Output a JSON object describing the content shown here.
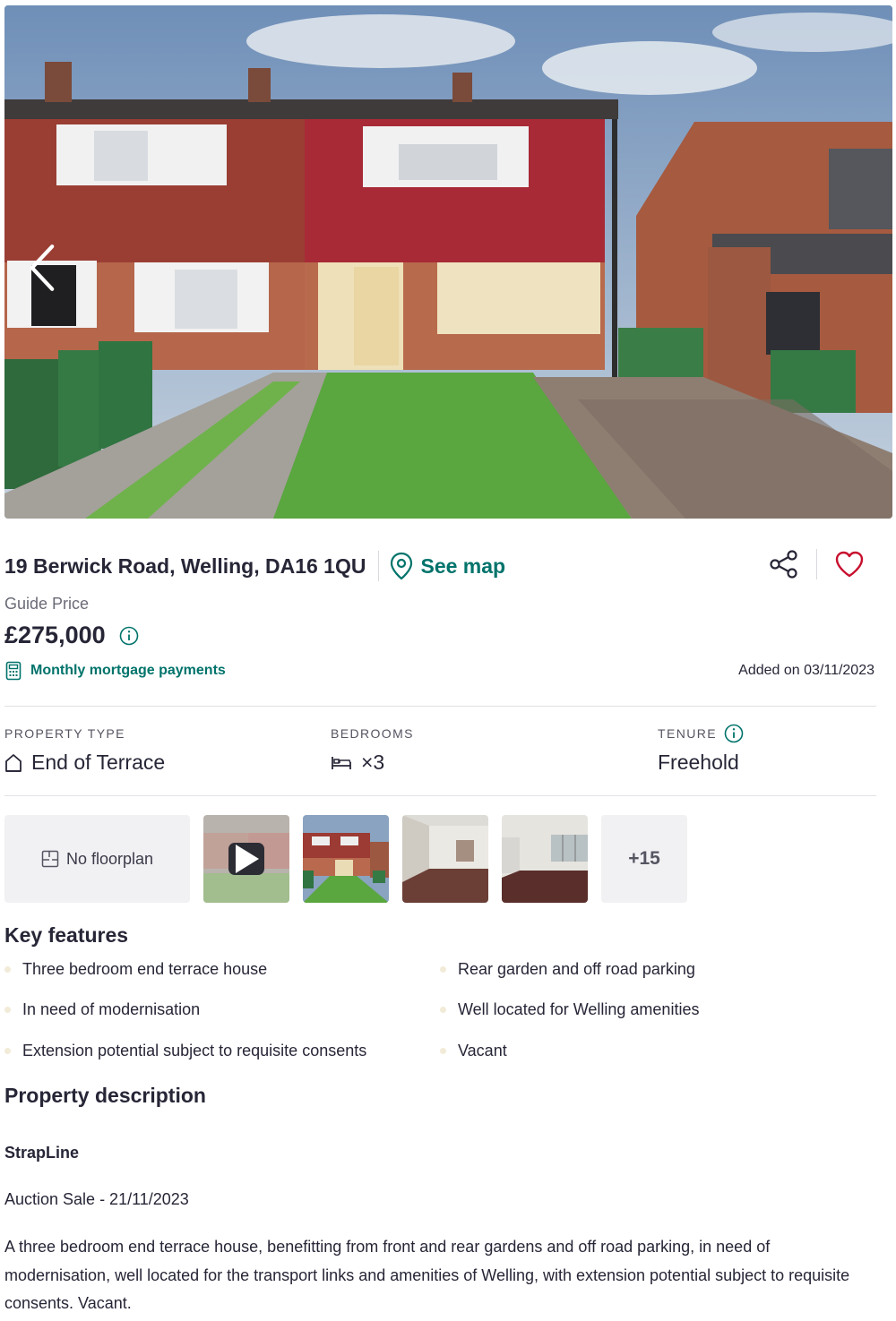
{
  "property": {
    "address": "19 Berwick Road, Welling, DA16 1QU",
    "see_map": "See map",
    "guide_label": "Guide Price",
    "price": "£275,000",
    "mortgage_link": "Monthly mortgage payments",
    "added": "Added on 03/11/2023"
  },
  "stats": {
    "type_label": "PROPERTY TYPE",
    "type_value": "End of Terrace",
    "bedrooms_label": "BEDROOMS",
    "bedrooms_value": "×3",
    "tenure_label": "TENURE",
    "tenure_value": "Freehold"
  },
  "gallery": {
    "floorplan_label": "No floorplan",
    "more_count": "+15"
  },
  "key_features": {
    "heading": "Key features",
    "items": [
      "Three bedroom end terrace house",
      "Rear garden and off road parking",
      "In need of modernisation",
      "Well located for Welling amenities",
      "Extension potential subject to requisite consents",
      "Vacant"
    ]
  },
  "description": {
    "heading": "Property description",
    "strapline_heading": "StrapLine",
    "auction": "Auction Sale - 21/11/2023",
    "body": "A three bedroom end terrace house, benefitting from front and rear gardens and off road parking, in need of modernisation, well located for the transport links and amenities of Welling, with extension potential subject to requisite consents. Vacant."
  },
  "icons": {
    "prev": "chevron-left-icon",
    "map": "map-pin-icon",
    "share": "share-icon",
    "favourite": "heart-icon",
    "info": "info-icon",
    "calculator": "calculator-icon",
    "house": "house-icon",
    "bed": "bed-icon",
    "floorplan": "floorplan-icon",
    "play": "play-icon"
  },
  "colors": {
    "accent": "#00736b",
    "heart": "#c8102e",
    "text": "#262637"
  }
}
